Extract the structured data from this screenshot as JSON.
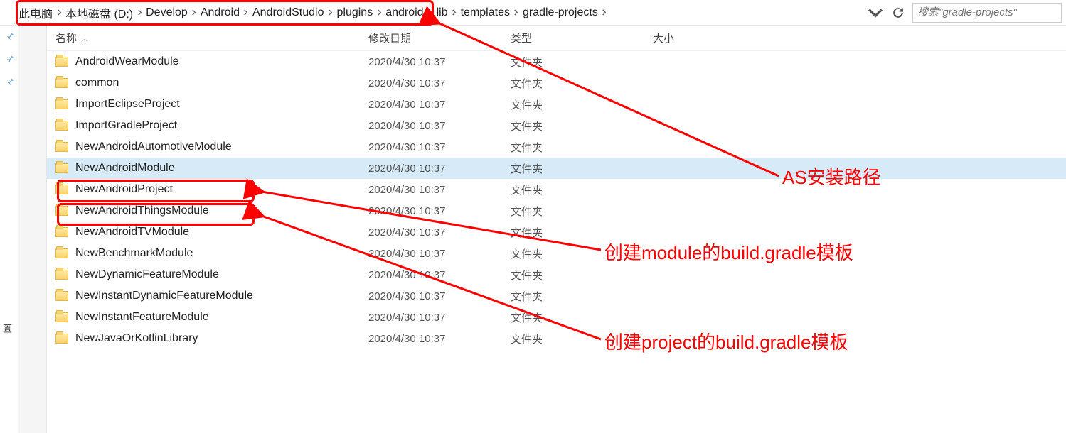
{
  "breadcrumbs": [
    {
      "label": "此电脑"
    },
    {
      "label": "本地磁盘 (D:)"
    },
    {
      "label": "Develop"
    },
    {
      "label": "Android"
    },
    {
      "label": "AndroidStudio"
    },
    {
      "label": "plugins"
    },
    {
      "label": "android"
    },
    {
      "label": "lib"
    },
    {
      "label": "templates"
    },
    {
      "label": "gradle-projects"
    }
  ],
  "search": {
    "placeholder": "搜索\"gradle-projects\""
  },
  "quick": {
    "label": "萱"
  },
  "columns": {
    "name": "名称",
    "modified": "修改日期",
    "type": "类型",
    "size": "大小"
  },
  "files": [
    {
      "name": "AndroidWearModule",
      "mod": "2020/4/30 10:37",
      "type": "文件夹",
      "selected": false
    },
    {
      "name": "common",
      "mod": "2020/4/30 10:37",
      "type": "文件夹",
      "selected": false
    },
    {
      "name": "ImportEclipseProject",
      "mod": "2020/4/30 10:37",
      "type": "文件夹",
      "selected": false
    },
    {
      "name": "ImportGradleProject",
      "mod": "2020/4/30 10:37",
      "type": "文件夹",
      "selected": false
    },
    {
      "name": "NewAndroidAutomotiveModule",
      "mod": "2020/4/30 10:37",
      "type": "文件夹",
      "selected": false
    },
    {
      "name": "NewAndroidModule",
      "mod": "2020/4/30 10:37",
      "type": "文件夹",
      "selected": true
    },
    {
      "name": "NewAndroidProject",
      "mod": "2020/4/30 10:37",
      "type": "文件夹",
      "selected": false
    },
    {
      "name": "NewAndroidThingsModule",
      "mod": "2020/4/30 10:37",
      "type": "文件夹",
      "selected": false
    },
    {
      "name": "NewAndroidTVModule",
      "mod": "2020/4/30 10:37",
      "type": "文件夹",
      "selected": false
    },
    {
      "name": "NewBenchmarkModule",
      "mod": "2020/4/30 10:37",
      "type": "文件夹",
      "selected": false
    },
    {
      "name": "NewDynamicFeatureModule",
      "mod": "2020/4/30 10:37",
      "type": "文件夹",
      "selected": false
    },
    {
      "name": "NewInstantDynamicFeatureModule",
      "mod": "2020/4/30 10:37",
      "type": "文件夹",
      "selected": false
    },
    {
      "name": "NewInstantFeatureModule",
      "mod": "2020/4/30 10:37",
      "type": "文件夹",
      "selected": false
    },
    {
      "name": "NewJavaOrKotlinLibrary",
      "mod": "2020/4/30 10:37",
      "type": "文件夹",
      "selected": false
    }
  ],
  "annotations": {
    "path": "AS安装路径",
    "module": "创建module的build.gradle模板",
    "project": "创建project的build.gradle模板"
  }
}
